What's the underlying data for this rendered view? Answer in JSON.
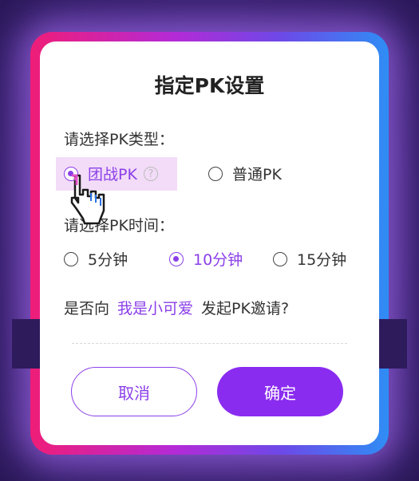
{
  "dialog": {
    "title": "指定PK设置",
    "type_label": "请选择PK类型：",
    "type_options": [
      {
        "label": "团战PK",
        "selected": true
      },
      {
        "label": "普通PK",
        "selected": false
      }
    ],
    "time_label": "请选择PK时间：",
    "time_options": [
      {
        "label": "5分钟",
        "selected": false
      },
      {
        "label": "10分钟",
        "selected": true
      },
      {
        "label": "15分钟",
        "selected": false
      }
    ],
    "invite_prefix": "是否向",
    "invite_target": "我是小可爱",
    "invite_suffix": "发起PK邀请?",
    "cancel_label": "取消",
    "confirm_label": "确定",
    "help_glyph": "?"
  },
  "colors": {
    "accent": "#8b3fe8",
    "frame_start": "#ef1d78",
    "frame_end": "#2f8df5",
    "background": "#2e1b5c"
  }
}
